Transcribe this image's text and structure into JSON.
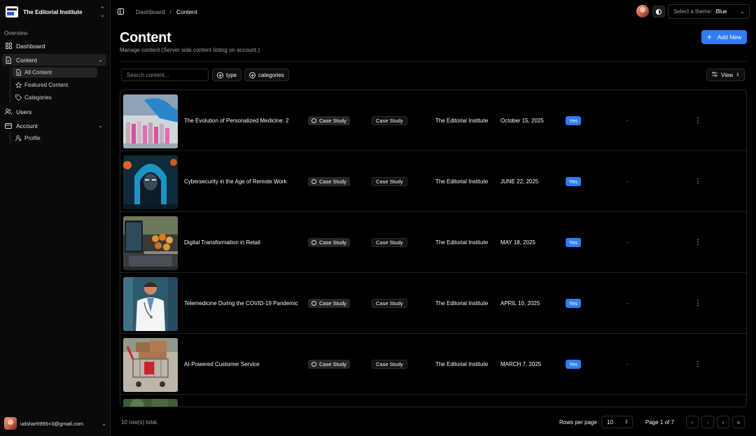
{
  "sidebar": {
    "brand": "The Editorial Institute",
    "section_label": "Overview",
    "items": [
      {
        "label": "Dashboard"
      },
      {
        "label": "Content"
      },
      {
        "label": "Users"
      },
      {
        "label": "Account"
      }
    ],
    "content_sub": [
      {
        "label": "All Content"
      },
      {
        "label": "Featured Content"
      },
      {
        "label": "Categories"
      }
    ],
    "account_sub": [
      {
        "label": "Profile"
      }
    ],
    "user_email": "udshar5995+3@gmail.com"
  },
  "topbar": {
    "breadcrumb_root": "Dashboard",
    "breadcrumb_sep": "/",
    "breadcrumb_current": "Content",
    "theme_label": "Select a theme:",
    "theme_value": "Blue"
  },
  "header": {
    "title": "Content",
    "subtitle": "Manage content (Server side content listing on account.)",
    "add_label": "Add New"
  },
  "toolbar": {
    "search_placeholder": "Search content...",
    "filter_type": "type",
    "filter_categories": "categories",
    "view_label": "View"
  },
  "rows": [
    {
      "title": "The Evolution of Personalized Medicine: 2",
      "type": "Case Study",
      "category": "Case Study",
      "author": "The Editorial Institute",
      "date": "October 15, 2025",
      "featured": "Yes",
      "extra": "-"
    },
    {
      "title": "Cybersecurity in the Age of Remote Work",
      "type": "Case Study",
      "category": "Case Study",
      "author": "The Editorial Institute",
      "date": "JUNE 22, 2025",
      "featured": "Yes",
      "extra": "-"
    },
    {
      "title": "Digital Transformation in Retail",
      "type": "Case Study",
      "category": "Case Study",
      "author": "The Editorial Institute",
      "date": "MAY 18, 2025",
      "featured": "Yes",
      "extra": "-"
    },
    {
      "title": "Telemedicine During the COVID-19 Pandemic",
      "type": "Case Study",
      "category": "Case Study",
      "author": "The Editorial Institute",
      "date": "APRIL 10, 2025",
      "featured": "Yes",
      "extra": "-"
    },
    {
      "title": "AI-Powered Customer Service",
      "type": "Case Study",
      "category": "Case Study",
      "author": "The Editorial Institute",
      "date": "MARCH 7, 2025",
      "featured": "Yes",
      "extra": "-"
    }
  ],
  "footer": {
    "row_count": "10 row(s) total.",
    "rows_per_page_label": "Rows per page",
    "rows_per_page_value": "10",
    "page_info": "Page 1 of 7"
  },
  "colors": {
    "accent": "#2f7cf6",
    "background": "#000000",
    "sidebar": "#0a0a0a"
  }
}
